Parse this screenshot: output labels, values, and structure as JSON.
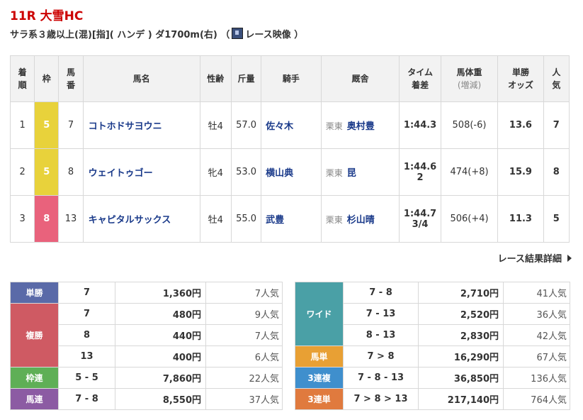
{
  "race": {
    "title": "11R 大雪HC",
    "info": "サラ系３歳以上(混)[指]( ハンデ ) ダ1700m(右) （",
    "video_label": "レース映像",
    "info_close": " ）"
  },
  "results": {
    "headers": {
      "rank": [
        "着",
        "順"
      ],
      "waku": "枠",
      "num": [
        "馬",
        "番"
      ],
      "name": "馬名",
      "sex_age": "性齢",
      "weight": "斤量",
      "jockey": "騎手",
      "stable": "厩舎",
      "time": [
        "タイム",
        "着差"
      ],
      "body_weight": [
        "馬体重",
        "(増減)"
      ],
      "odds": [
        "単勝",
        "オッズ"
      ],
      "popularity": [
        "人",
        "気"
      ]
    },
    "rows": [
      {
        "rank": "1",
        "waku": "5",
        "num": "7",
        "name": "コトホドサヨウニ",
        "sex_age": "牡4",
        "weight": "57.0",
        "jockey": "佐々木",
        "stable_area": "栗東",
        "trainer": "奥村豊",
        "time": "1:44.3",
        "margin": "",
        "body_weight": "508(-6)",
        "odds": "13.6",
        "pop": "7"
      },
      {
        "rank": "2",
        "waku": "5",
        "num": "8",
        "name": "ウェイトゥゴー",
        "sex_age": "牝4",
        "weight": "53.0",
        "jockey": "横山典",
        "stable_area": "栗東",
        "trainer": "昆",
        "time": "1:44.6",
        "margin": "2",
        "body_weight": "474(+8)",
        "odds": "15.9",
        "pop": "8"
      },
      {
        "rank": "3",
        "waku": "8",
        "num": "13",
        "name": "キャピタルサックス",
        "sex_age": "牡4",
        "weight": "55.0",
        "jockey": "武豊",
        "stable_area": "栗東",
        "trainer": "杉山晴",
        "time": "1:44.7",
        "margin": "3/4",
        "body_weight": "506(+4)",
        "odds": "11.3",
        "pop": "5"
      }
    ]
  },
  "detail_link": "レース結果詳細",
  "payouts_left": {
    "tansho": {
      "label": "単勝",
      "rows": [
        {
          "combo": "7",
          "amount": "1,360円",
          "pop": "7人気"
        }
      ]
    },
    "fukusho": {
      "label": "複勝",
      "rows": [
        {
          "combo": "7",
          "amount": "480円",
          "pop": "9人気"
        },
        {
          "combo": "8",
          "amount": "440円",
          "pop": "7人気"
        },
        {
          "combo": "13",
          "amount": "400円",
          "pop": "6人気"
        }
      ]
    },
    "wakuren": {
      "label": "枠連",
      "rows": [
        {
          "combo": "5 - 5",
          "amount": "7,860円",
          "pop": "22人気"
        }
      ]
    },
    "umaren": {
      "label": "馬連",
      "rows": [
        {
          "combo": "7 - 8",
          "amount": "8,550円",
          "pop": "37人気"
        }
      ]
    }
  },
  "payouts_right": {
    "wide": {
      "label": "ワイド",
      "rows": [
        {
          "combo": "7 - 8",
          "amount": "2,710円",
          "pop": "41人気"
        },
        {
          "combo": "7 - 13",
          "amount": "2,520円",
          "pop": "36人気"
        },
        {
          "combo": "8 - 13",
          "amount": "2,830円",
          "pop": "42人気"
        }
      ]
    },
    "umatan": {
      "label": "馬単",
      "rows": [
        {
          "combo": "7 > 8",
          "amount": "16,290円",
          "pop": "67人気"
        }
      ]
    },
    "sanpuku": {
      "label": "3連複",
      "rows": [
        {
          "combo": "7 - 8 - 13",
          "amount": "36,850円",
          "pop": "136人気"
        }
      ]
    },
    "santan": {
      "label": "3連単",
      "rows": [
        {
          "combo": "7 > 8 > 13",
          "amount": "217,140円",
          "pop": "764人気"
        }
      ]
    }
  },
  "colors": {
    "title": "#cc0000",
    "waku5": "#e8d23b",
    "waku8": "#e9627c",
    "link": "#1a3a8a"
  }
}
